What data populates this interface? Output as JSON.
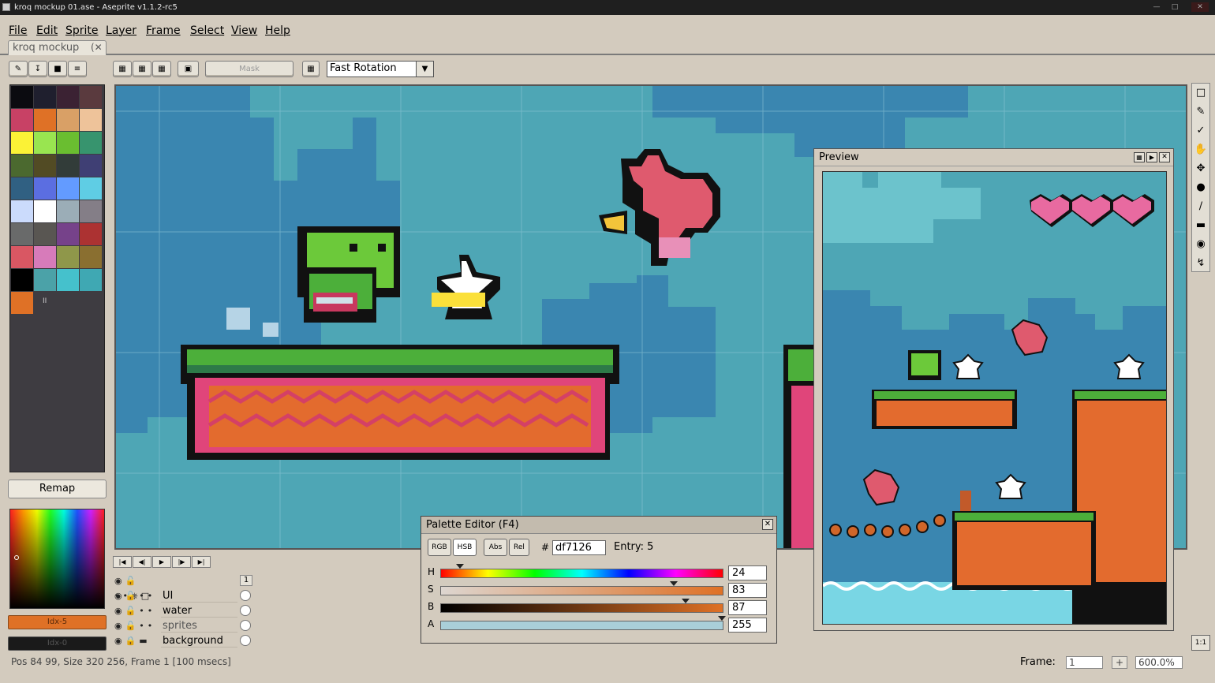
{
  "window": {
    "title": "kroq mockup 01.ase - Aseprite v1.1.2-rc5"
  },
  "menu": [
    "File",
    "Edit",
    "Sprite",
    "Layer",
    "Frame",
    "Select",
    "View",
    "Help"
  ],
  "tab": {
    "label": "kroq mockup",
    "close_icon": "close-icon"
  },
  "toolbar": {
    "mask_label": "Mask",
    "rotation_value": "Fast Rotation"
  },
  "palette": {
    "swatches": [
      "#0b0b10",
      "#1f1f2e",
      "#3b2233",
      "#5a3a3e",
      "#c84165",
      "#df7126",
      "#d9a066",
      "#eec39a",
      "#fbf236",
      "#99e550",
      "#6abe30",
      "#37946e",
      "#4b692f",
      "#524b24",
      "#323c39",
      "#3f3f74",
      "#306082",
      "#5b6ee1",
      "#639bff",
      "#5fcde4",
      "#cbdbfc",
      "#ffffff",
      "#9badb7",
      "#847e87",
      "#696a6a",
      "#595652",
      "#76428a",
      "#ac3232",
      "#d95763",
      "#d77bba",
      "#8f974a",
      "#8a6f30",
      "#000000",
      "#4ba2a8",
      "#45c1cc",
      "#3fa8b3",
      "#df7126"
    ],
    "remap_label": "Remap",
    "fg_label": "Idx-5",
    "bg_label": "Idx-0",
    "fg_color": "#df7126"
  },
  "palette_editor": {
    "title": "Palette Editor (F4)",
    "mode_buttons": [
      "RGB",
      "HSB",
      "Abs",
      "Rel"
    ],
    "hash": "#",
    "hex_value": "df7126",
    "entry_label": "Entry: 5",
    "channels": [
      {
        "label": "H",
        "value": "24",
        "level": 0.07
      },
      {
        "label": "S",
        "value": "83",
        "level": 0.83
      },
      {
        "label": "B",
        "value": "87",
        "level": 0.87
      },
      {
        "label": "A",
        "value": "255",
        "level": 1.0
      }
    ]
  },
  "layers": [
    {
      "name": "UI"
    },
    {
      "name": "water"
    },
    {
      "name": "sprites"
    },
    {
      "name": "background"
    }
  ],
  "layer_frame_header": "1",
  "preview": {
    "title": "Preview"
  },
  "status": {
    "text": "Pos 84 99, Size 320 256, Frame 1 [100 msecs]",
    "frame_label": "Frame:",
    "frame_value": "1",
    "add_frame": "+",
    "zoom_value": "600.0%",
    "one_to_one": "1:1"
  }
}
